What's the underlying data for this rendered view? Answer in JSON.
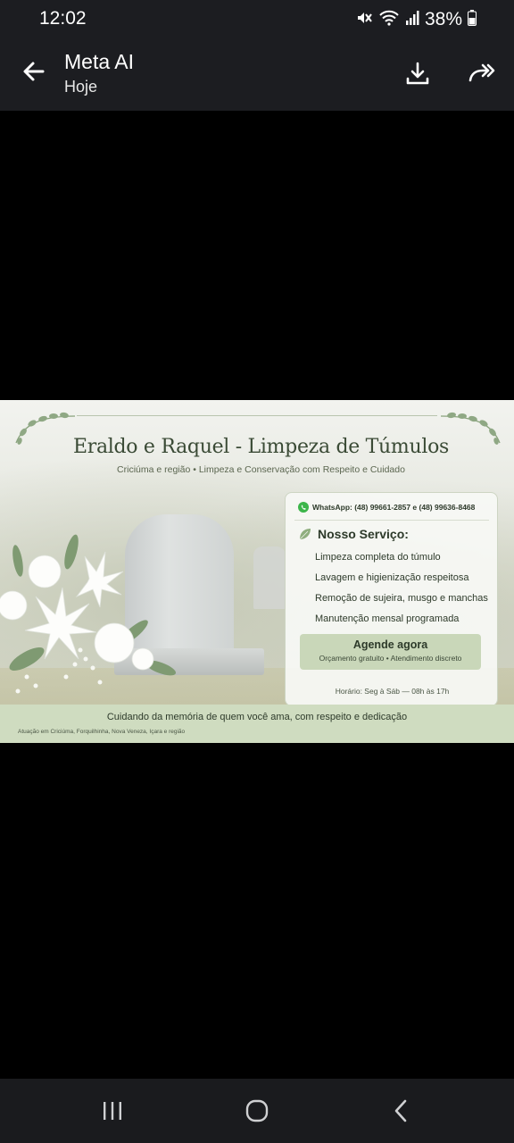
{
  "status_bar": {
    "time": "12:02",
    "battery": "38%",
    "icons": [
      "mute-icon",
      "wifi-icon",
      "signal-icon",
      "battery-icon"
    ]
  },
  "header": {
    "title": "Meta AI",
    "subtitle": "Hoje",
    "icons": [
      "back-arrow-icon",
      "download-icon",
      "share-forward-icon"
    ]
  },
  "flyer": {
    "title": "Eraldo e Raquel - Limpeza de Túmulos",
    "subtitle": "Criciúma e região • Limpeza e Conservação com Respeito e Cuidado",
    "whatsapp": "WhatsApp: (48) 99661-2857 e (48) 99636-8468",
    "service_heading": "Nosso Serviço:",
    "services": [
      "Limpeza completa do túmulo",
      "Lavagem e higienização respeitosa",
      "Remoção de sujeira, musgo e manchas",
      "Manutenção mensal programada"
    ],
    "cta_title": "Agende agora",
    "cta_sub": "Orçamento gratuito • Atendimento discreto",
    "hours": "Horário: Seg à Sáb — 08h às 17h",
    "tagline": "Cuidando da memória de quem você ama, com respeito e dedicação",
    "area": "Atuação em Criciúma, Forquilhinha, Nova Veneza, Içara e região",
    "colors": {
      "accent_green": "#c9d7b9",
      "text_dark": "#2d3a2a",
      "whatsapp": "#3cb54a"
    }
  },
  "nav_bar": {
    "icons": [
      "recents-icon",
      "home-icon",
      "back-icon"
    ]
  }
}
